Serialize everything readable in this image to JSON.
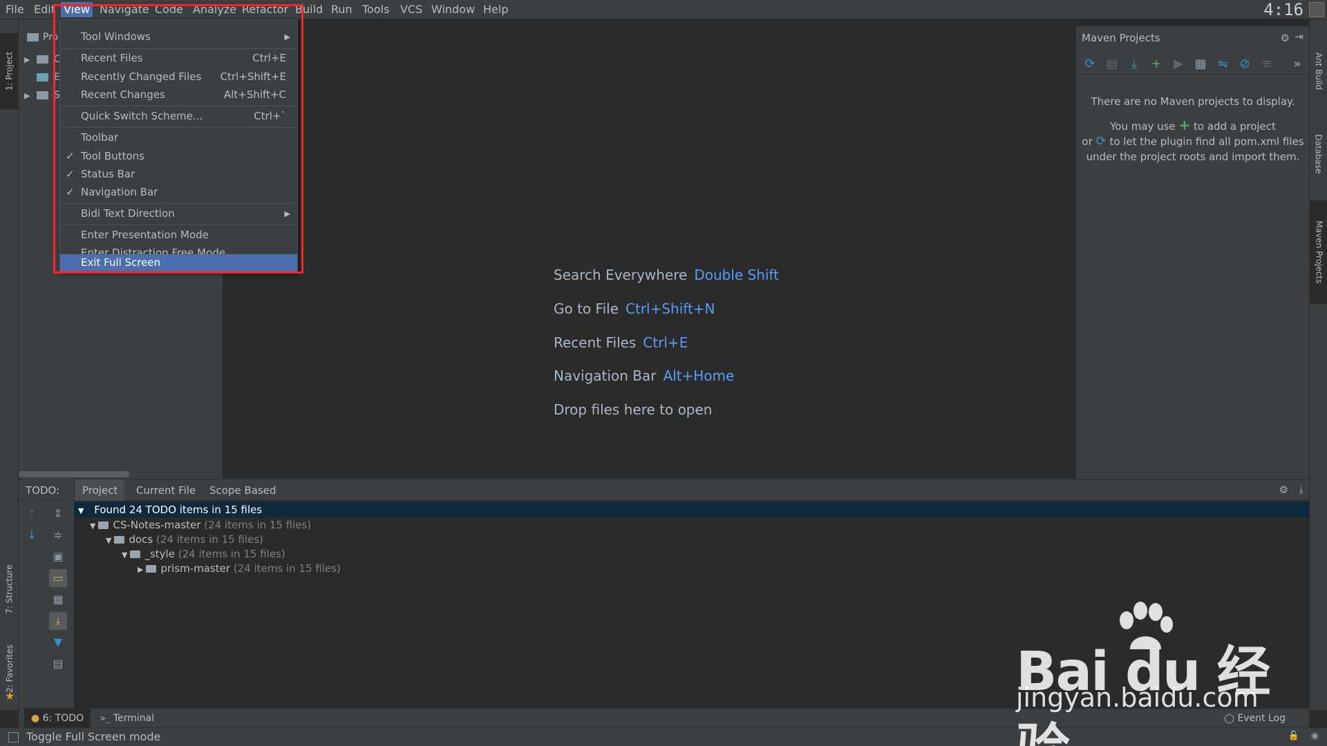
{
  "menubar": {
    "items": [
      "File",
      "Edit",
      "View",
      "Navigate",
      "Code",
      "Analyze",
      "Refactor",
      "Build",
      "Run",
      "Tools",
      "VCS",
      "Window",
      "Help"
    ],
    "active": "View",
    "clock": "4:16"
  },
  "view_menu": {
    "items": [
      {
        "label": "Tool Windows",
        "shortcut": "",
        "checked": false,
        "submenu": true
      },
      {
        "label": "Recent Files",
        "shortcut": "Ctrl+E",
        "checked": false,
        "submenu": false
      },
      {
        "label": "Recently Changed Files",
        "shortcut": "Ctrl+Shift+E",
        "checked": false,
        "submenu": false
      },
      {
        "label": "Recent Changes",
        "shortcut": "Alt+Shift+C",
        "checked": false,
        "submenu": false
      },
      {
        "label": "Quick Switch Scheme...",
        "shortcut": "Ctrl+`",
        "checked": false,
        "submenu": false
      },
      {
        "label": "Toolbar",
        "shortcut": "",
        "checked": false,
        "submenu": false
      },
      {
        "label": "Tool Buttons",
        "shortcut": "",
        "checked": true,
        "submenu": false
      },
      {
        "label": "Status Bar",
        "shortcut": "",
        "checked": true,
        "submenu": false
      },
      {
        "label": "Navigation Bar",
        "shortcut": "",
        "checked": true,
        "submenu": false
      },
      {
        "label": "Bidi Text Direction",
        "shortcut": "",
        "checked": false,
        "submenu": true
      },
      {
        "label": "Enter Presentation Mode",
        "shortcut": "",
        "checked": false,
        "submenu": false
      },
      {
        "label": "Enter Distraction Free Mode",
        "shortcut": "",
        "checked": false,
        "submenu": false
      },
      {
        "label": "Exit Full Screen",
        "shortcut": "",
        "checked": false,
        "submenu": false,
        "highlighted": true
      }
    ]
  },
  "left_stripe": {
    "project": "1: Project",
    "structure": "7: Structure",
    "favorites": "2: Favorites"
  },
  "right_stripe": {
    "ant": "Ant Build",
    "database": "Database",
    "maven": "Maven Projects"
  },
  "project_panel": {
    "title": "Pro",
    "rows": [
      "C",
      "E",
      "S"
    ]
  },
  "editor": {
    "hints": [
      {
        "label": "Search Everywhere",
        "key": "Double Shift"
      },
      {
        "label": "Go to File",
        "key": "Ctrl+Shift+N"
      },
      {
        "label": "Recent Files",
        "key": "Ctrl+E"
      },
      {
        "label": "Navigation Bar",
        "key": "Alt+Home"
      },
      {
        "label": "Drop files here to open",
        "key": ""
      }
    ]
  },
  "maven": {
    "title": "Maven Projects",
    "no_projects": "There are no Maven projects to display.",
    "line1_pre": "You may use",
    "line1_post": "to add a project",
    "line2_pre": "or",
    "line2_post": "to let the plugin find all pom.xml files",
    "line3": "under the project roots and import them.",
    "colors": {
      "plus": "#59a869",
      "refresh": "#3592c4"
    }
  },
  "todo": {
    "label": "TODO:",
    "tabs": [
      "Project",
      "Current File",
      "Scope Based"
    ],
    "summary": "Found 24 TODO items in 15 files",
    "tree": [
      {
        "name": "CS-Notes-master",
        "count": "(24 items in 15 files)"
      },
      {
        "name": "docs",
        "count": "(24 items in 15 files)"
      },
      {
        "name": "_style",
        "count": "(24 items in 15 files)"
      },
      {
        "name": "prism-master",
        "count": "(24 items in 15 files)"
      }
    ]
  },
  "tool_windows": {
    "todo": "6: TODO",
    "terminal": "Terminal",
    "event_log": "Event Log"
  },
  "status": {
    "text": "Toggle Full Screen mode"
  },
  "watermark": {
    "brand": "Bai du 经验",
    "url": "jingyan.baidu.com"
  },
  "colors": {
    "selection": "#4b6eaf",
    "link_key": "#589df6",
    "annotation_box": "#ff2222"
  }
}
